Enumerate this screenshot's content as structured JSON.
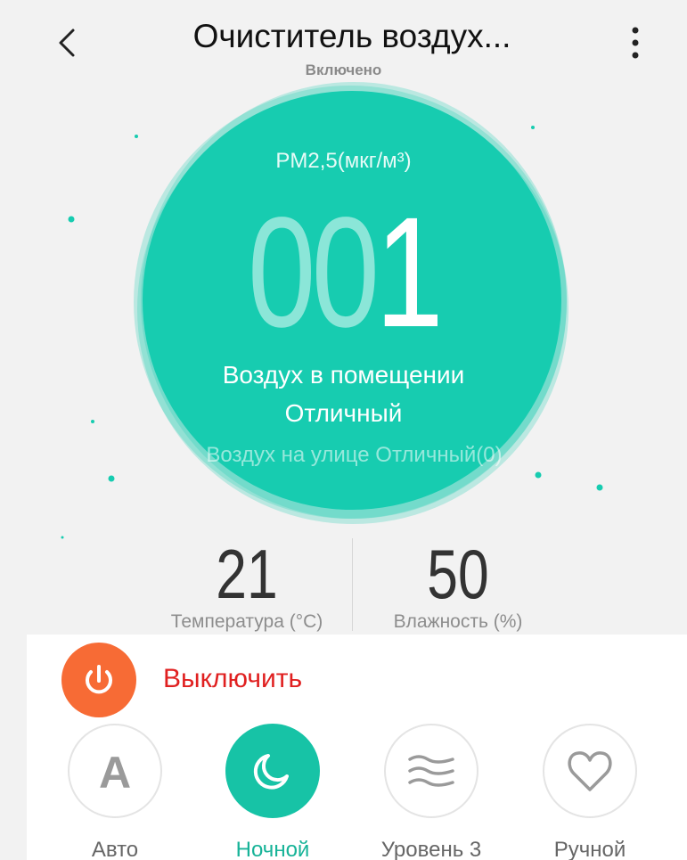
{
  "header": {
    "title": "Очиститель воздух...",
    "status": "Включено"
  },
  "reading": {
    "label": "PM2,5(мкг/м³)",
    "value_leading_zeros": "00",
    "value_significant": "1",
    "indoor_label": "Воздух в помещении",
    "indoor_status": "Отличный",
    "outdoor": "Воздух на улице Отличный(0)"
  },
  "stats": {
    "temperature": {
      "value": "21",
      "label": "Температура (°C)"
    },
    "humidity": {
      "value": "50",
      "label": "Влажность (%)"
    }
  },
  "controls": {
    "power_label": "Выключить",
    "modes": [
      {
        "label": "Авто",
        "icon": "letter-a-icon",
        "active": false
      },
      {
        "label": "Ночной",
        "icon": "moon-icon",
        "active": true
      },
      {
        "label": "Уровень 3",
        "icon": "wind-waves-icon",
        "active": false
      },
      {
        "label": "Ручной",
        "icon": "heart-icon",
        "active": false
      }
    ]
  },
  "colors": {
    "accent": "#17ccb0",
    "power": "#f76b35",
    "power_text": "#e02020"
  }
}
